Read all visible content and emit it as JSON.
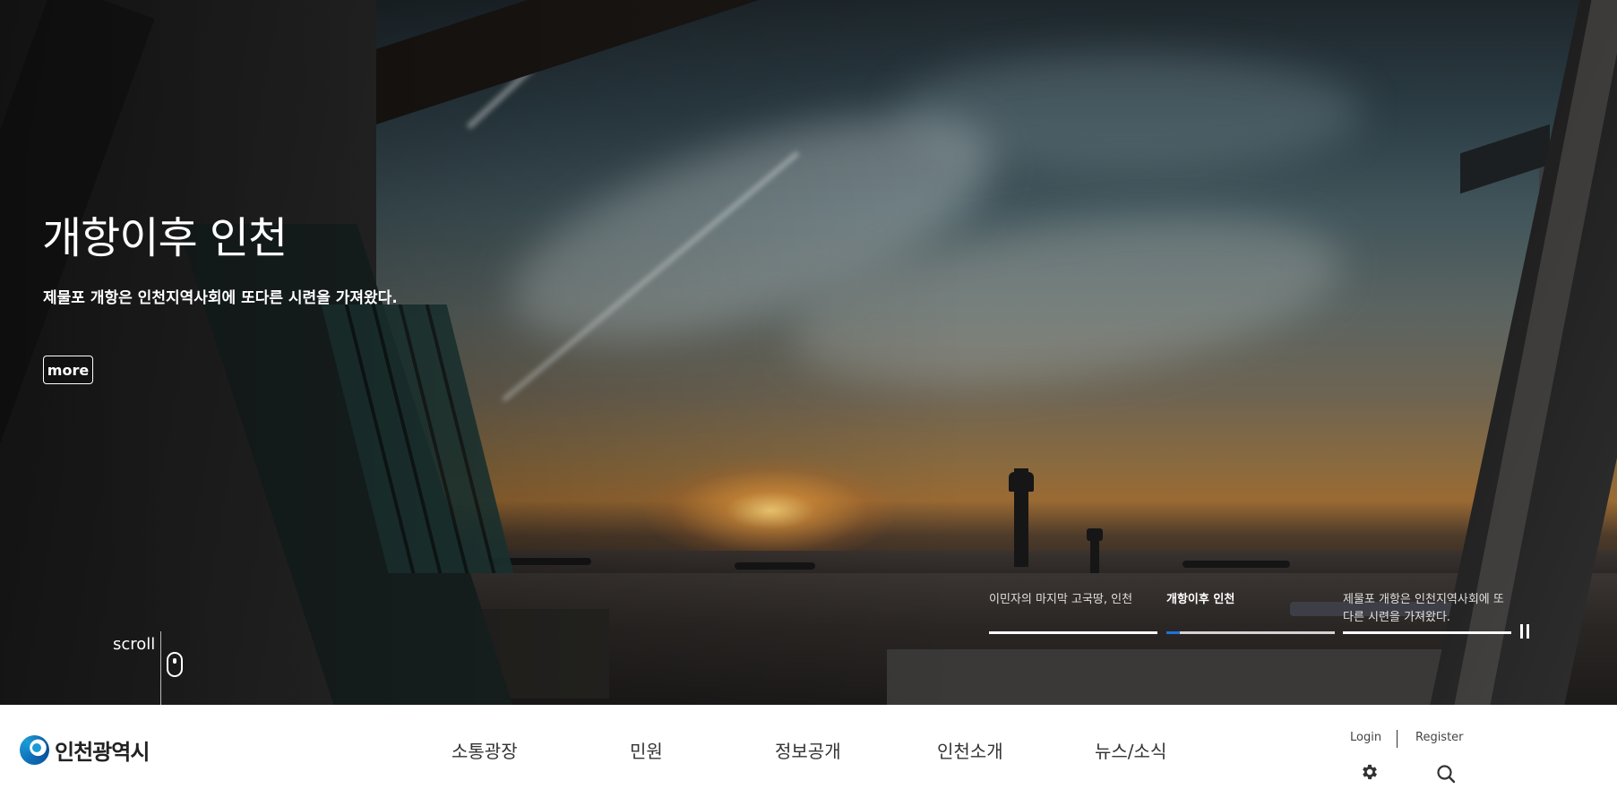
{
  "hero": {
    "title": "개항이후 인천",
    "subtitle": "제물포 개항은 인천지역사회에 또다른 시련을 가져왔다.",
    "more_label": "more",
    "scroll_label": "scroll"
  },
  "slides": [
    {
      "label": "이민자의 마지막 고국땅, 인천",
      "active": false,
      "progress": 1.0
    },
    {
      "label": "개항이후 인천",
      "active": true,
      "progress": 0.08
    },
    {
      "label": "제물포 개항은 인천지역사회에 또다른 시련을 가져왔다.",
      "active": false,
      "progress": 1.0
    }
  ],
  "pause_icon": "pause-icon",
  "header": {
    "logo_text": "인천광역시",
    "nav": [
      "소통광장",
      "민원",
      "정보공개",
      "인천소개",
      "뉴스/소식"
    ],
    "login_label": "Login",
    "register_label": "Register",
    "settings_icon": "gear-icon",
    "search_icon": "search-icon"
  },
  "colors": {
    "accent": "#1e73d8",
    "logo_blue": "#0f6cb6"
  }
}
